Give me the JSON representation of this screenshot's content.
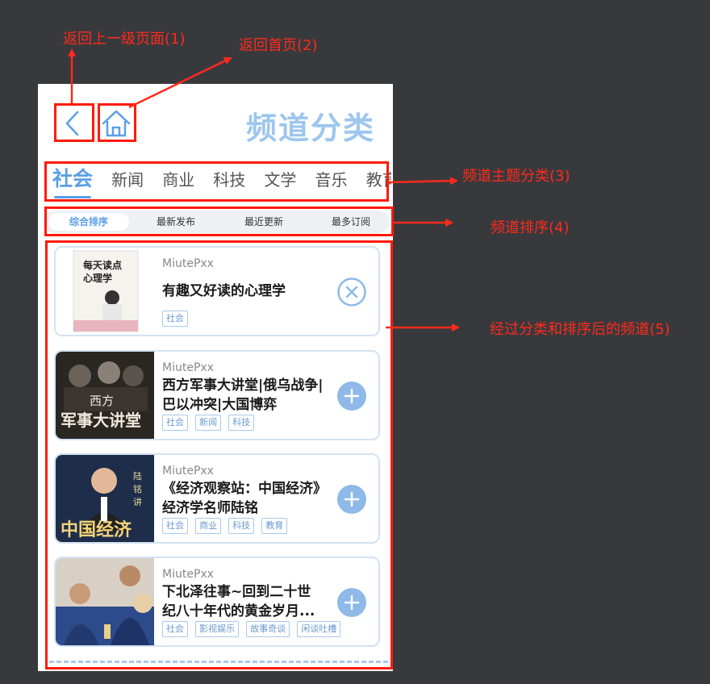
{
  "annotations": {
    "back": "返回上一级页面(1)",
    "home": "返回首页(2)",
    "tabs": "频道主题分类(3)",
    "sort": "频道排序(4)",
    "list": "经过分类和排序后的频道(5)"
  },
  "header": {
    "title": "频道分类"
  },
  "tabs": [
    "社会",
    "新闻",
    "商业",
    "科技",
    "文学",
    "音乐",
    "教育"
  ],
  "sort_options": [
    "综合排序",
    "最新发布",
    "最近更新",
    "最多订阅"
  ],
  "channels": [
    {
      "author": "MiutePxx",
      "title": "有趣又好读的心理学",
      "tags": [
        "社会"
      ],
      "action": "remove",
      "cover_text": "每天读点\n心理学"
    },
    {
      "author": "MiutePxx",
      "title": "西方军事大讲堂|俄乌战争|巴以冲突|大国博弈",
      "tags": [
        "社会",
        "新闻",
        "科技"
      ],
      "action": "add",
      "cover_text": "西方\n军事大讲堂"
    },
    {
      "author": "MiutePxx",
      "title": "《经济观察站：中国经济》经济学名师陆铭",
      "tags": [
        "社会",
        "商业",
        "科技",
        "教育"
      ],
      "action": "add",
      "cover_text": "中国经济\n陆铭讲"
    },
    {
      "author": "MiutePxx",
      "title": "下北泽往事~回到二十世纪八十年代的黄金岁月...",
      "tags": [
        "社会",
        "影视娱乐",
        "故事奇谈",
        "闲谈吐槽"
      ],
      "action": "add",
      "cover_text": ""
    }
  ],
  "colors": {
    "accent": "#5aa0e6",
    "annotation": "#ff2a1a",
    "background": "#38393d"
  }
}
